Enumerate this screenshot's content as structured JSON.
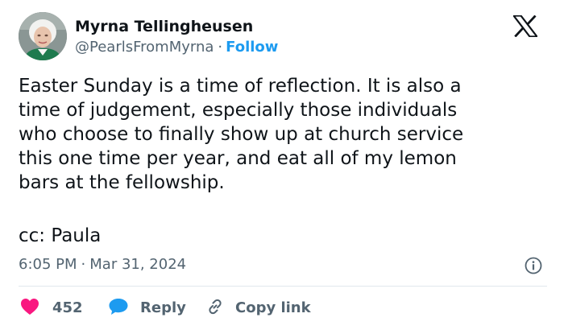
{
  "author": {
    "display_name": "Myrna Tellingheusen",
    "handle": "@PearlsFromMyrna",
    "separator": "·",
    "follow_label": "Follow"
  },
  "tweet": {
    "text": "Easter Sunday is a time of reflection. It is also a\ntime of judgement, especially those individuals\nwho choose to finally show up at church service\nthis one time per year, and eat all of my lemon\nbars at the fellowship.",
    "cc_line": "cc: Paula",
    "time": "6:05 PM",
    "date_separator": "·",
    "date": "Mar 31, 2024"
  },
  "actions": {
    "like_count": "452",
    "reply_label": "Reply",
    "copy_link_label": "Copy link"
  },
  "icons": {
    "logo": "x-logo-icon",
    "info": "info-icon",
    "like": "heart-icon",
    "reply": "speech-bubble-icon",
    "copy": "link-icon"
  },
  "colors": {
    "text": "#0f1419",
    "secondary": "#536471",
    "follow": "#1d9bf0",
    "heart": "#f91880",
    "reply_bubble": "#1d9bf0",
    "divider": "#e1e8ed"
  }
}
